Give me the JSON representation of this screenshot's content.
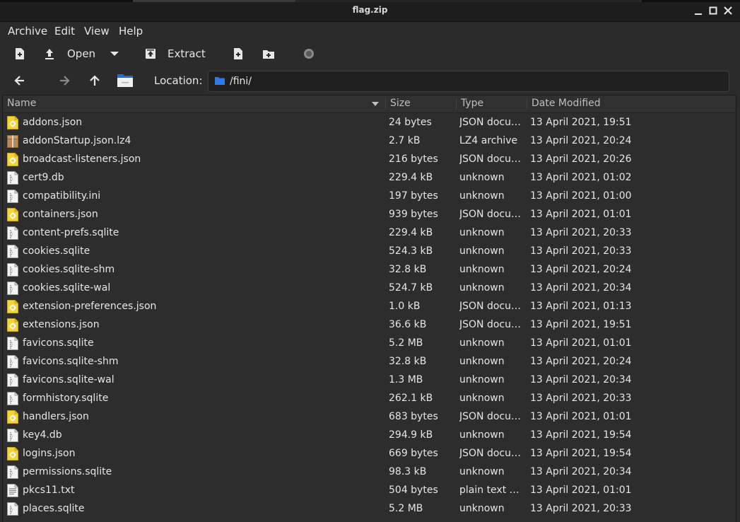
{
  "window": {
    "title": "flag.zip"
  },
  "menu": [
    "Archive",
    "Edit",
    "View",
    "Help"
  ],
  "toolbar": {
    "open_label": "Open",
    "extract_label": "Extract"
  },
  "location": {
    "label": "Location:",
    "path": "/fini/"
  },
  "columns": {
    "name": "Name",
    "size": "Size",
    "type": "Type",
    "date": "Date Modified"
  },
  "files": [
    {
      "name": "addons.json",
      "size": "24 bytes",
      "type": "JSON docu…",
      "date": "13 April 2021, 19:51",
      "icon": "json-file-icon"
    },
    {
      "name": "addonStartup.json.lz4",
      "size": "2.7 kB",
      "type": "LZ4 archive",
      "date": "13 April 2021, 20:24",
      "icon": "archive-file-icon"
    },
    {
      "name": "broadcast-listeners.json",
      "size": "216 bytes",
      "type": "JSON docu…",
      "date": "13 April 2021, 20:26",
      "icon": "json-file-icon"
    },
    {
      "name": "cert9.db",
      "size": "229.4 kB",
      "type": "unknown",
      "date": "13 April 2021, 01:02",
      "icon": "generic-file-icon"
    },
    {
      "name": "compatibility.ini",
      "size": "197 bytes",
      "type": "unknown",
      "date": "13 April 2021, 01:00",
      "icon": "generic-file-icon"
    },
    {
      "name": "containers.json",
      "size": "939 bytes",
      "type": "JSON docu…",
      "date": "13 April 2021, 01:01",
      "icon": "json-file-icon"
    },
    {
      "name": "content-prefs.sqlite",
      "size": "229.4 kB",
      "type": "unknown",
      "date": "13 April 2021, 20:33",
      "icon": "generic-file-icon"
    },
    {
      "name": "cookies.sqlite",
      "size": "524.3 kB",
      "type": "unknown",
      "date": "13 April 2021, 20:33",
      "icon": "generic-file-icon"
    },
    {
      "name": "cookies.sqlite-shm",
      "size": "32.8 kB",
      "type": "unknown",
      "date": "13 April 2021, 20:24",
      "icon": "generic-file-icon"
    },
    {
      "name": "cookies.sqlite-wal",
      "size": "524.7 kB",
      "type": "unknown",
      "date": "13 April 2021, 20:34",
      "icon": "generic-file-icon"
    },
    {
      "name": "extension-preferences.json",
      "size": "1.0 kB",
      "type": "JSON docu…",
      "date": "13 April 2021, 01:13",
      "icon": "json-file-icon"
    },
    {
      "name": "extensions.json",
      "size": "36.6 kB",
      "type": "JSON docu…",
      "date": "13 April 2021, 19:51",
      "icon": "json-file-icon"
    },
    {
      "name": "favicons.sqlite",
      "size": "5.2 MB",
      "type": "unknown",
      "date": "13 April 2021, 01:01",
      "icon": "generic-file-icon"
    },
    {
      "name": "favicons.sqlite-shm",
      "size": "32.8 kB",
      "type": "unknown",
      "date": "13 April 2021, 20:24",
      "icon": "generic-file-icon"
    },
    {
      "name": "favicons.sqlite-wal",
      "size": "1.3 MB",
      "type": "unknown",
      "date": "13 April 2021, 20:34",
      "icon": "generic-file-icon"
    },
    {
      "name": "formhistory.sqlite",
      "size": "262.1 kB",
      "type": "unknown",
      "date": "13 April 2021, 20:33",
      "icon": "generic-file-icon"
    },
    {
      "name": "handlers.json",
      "size": "683 bytes",
      "type": "JSON docu…",
      "date": "13 April 2021, 01:01",
      "icon": "json-file-icon"
    },
    {
      "name": "key4.db",
      "size": "294.9 kB",
      "type": "unknown",
      "date": "13 April 2021, 19:54",
      "icon": "generic-file-icon"
    },
    {
      "name": "logins.json",
      "size": "669 bytes",
      "type": "JSON docu…",
      "date": "13 April 2021, 19:54",
      "icon": "json-file-icon"
    },
    {
      "name": "permissions.sqlite",
      "size": "98.3 kB",
      "type": "unknown",
      "date": "13 April 2021, 20:34",
      "icon": "generic-file-icon"
    },
    {
      "name": "pkcs11.txt",
      "size": "504 bytes",
      "type": "plain text do…",
      "date": "13 April 2021, 01:01",
      "icon": "text-file-icon"
    },
    {
      "name": "places.sqlite",
      "size": "5.2 MB",
      "type": "unknown",
      "date": "13 April 2021, 20:33",
      "icon": "generic-file-icon"
    }
  ]
}
